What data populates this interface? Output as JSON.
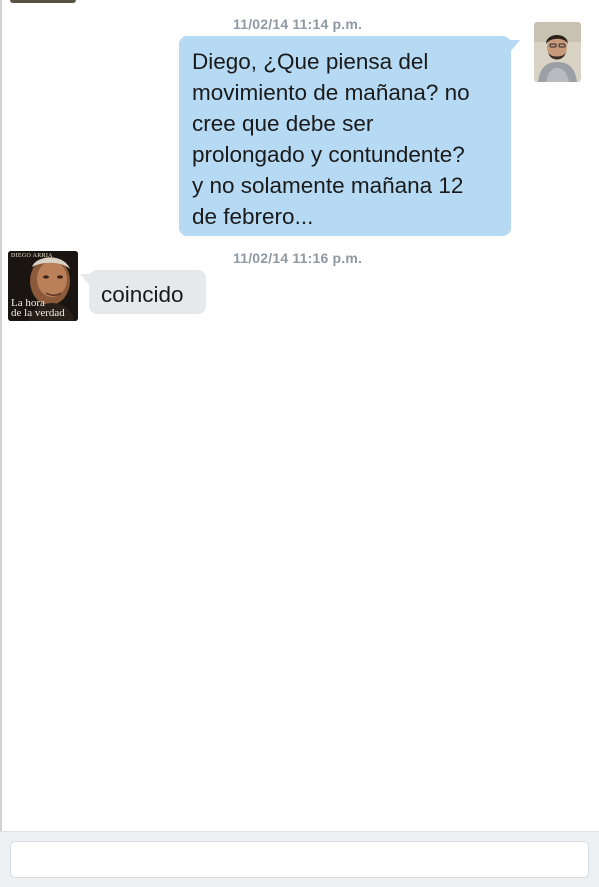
{
  "messages": [
    {
      "timestamp": "11/02/14 11:14 p.m.",
      "direction": "outgoing",
      "text": "Diego, ¿Que piensa del movimiento de mañana? no cree que debe ser prolongado y contundente? y no solamente mañana 12 de febrero...",
      "lines": [
        "Diego, ¿Que piensa del",
        "movimiento de mañana? no",
        "cree que debe ser",
        "prolongado y contundente?",
        "y no solamente mañana 12",
        "de febrero..."
      ],
      "avatar_icon": "user-photo-avatar"
    },
    {
      "timestamp": "11/02/14 11:16 p.m.",
      "direction": "incoming",
      "text": "coincido",
      "avatar_icon": "book-cover-avatar",
      "avatar_cover": {
        "brand": "DIEGO ARRIA",
        "title_line1": "La hora",
        "title_line2": "de la verdad"
      }
    }
  ],
  "composer": {
    "value": "",
    "placeholder": ""
  },
  "colors": {
    "outgoing_bubble": "#b6daf4",
    "incoming_bubble": "#e6e9ec",
    "timestamp": "#8e99a3",
    "composer_bar": "#eef1f4"
  }
}
